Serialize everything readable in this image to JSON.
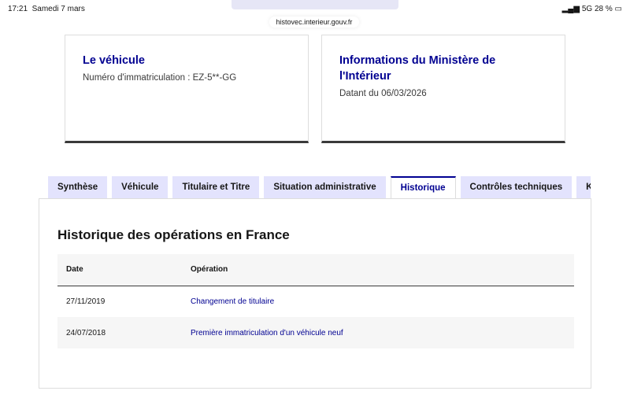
{
  "status": {
    "time": "17:21",
    "date": "Samedi 7 mars",
    "network": "5G",
    "battery": "28 %"
  },
  "browser": {
    "url": "histovec.interieur.gouv.fr"
  },
  "cards": [
    {
      "title": "Le véhicule",
      "text": "Numéro d'immatriculation : EZ-5**-GG"
    },
    {
      "title": "Informations du Ministère de l'Intérieur",
      "text": "Datant du 06/03/2026"
    }
  ],
  "tabs": [
    "Synthèse",
    "Véhicule",
    "Titulaire et Titre",
    "Situation administrative",
    "Historique",
    "Contrôles techniques",
    "Kilométrage"
  ],
  "active_tab": "Historique",
  "section": {
    "title": "Historique des opérations en France",
    "headers": [
      "Date",
      "Opération"
    ],
    "rows": [
      {
        "date": "27/11/2019",
        "operation": "Changement de titulaire"
      },
      {
        "date": "24/07/2018",
        "operation": "Première immatriculation d'un véhicule neuf"
      }
    ]
  },
  "colors": {
    "accent": "#000091",
    "tab_bg": "#e3e3fd"
  }
}
